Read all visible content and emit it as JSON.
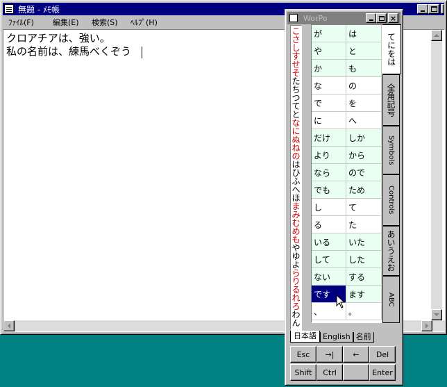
{
  "notepad": {
    "title": "無題 - ﾒﾓ帳",
    "menu": [
      "ﾌｧｲﾙ(F)",
      "編集(E)",
      "検索(S)",
      "ﾍﾙﾌﾟ(H)"
    ],
    "text": "クロアチアは、強い。\n私の名前は、練馬べくぞう"
  },
  "worpo": {
    "title": "WorPo",
    "vertical_strip": [
      {
        "t": "こ",
        "c": "#cc0000"
      },
      {
        "t": "さ",
        "c": "#cc0000"
      },
      {
        "t": "し",
        "c": "#cc0000"
      },
      {
        "t": "す",
        "c": "#cc0000"
      },
      {
        "t": "せ",
        "c": "#cc0000"
      },
      {
        "t": "そ",
        "c": "#cc0000"
      },
      {
        "t": "た",
        "c": "#000"
      },
      {
        "t": "ち",
        "c": "#000"
      },
      {
        "t": "つ",
        "c": "#000"
      },
      {
        "t": "て",
        "c": "#000"
      },
      {
        "t": "と",
        "c": "#000"
      },
      {
        "t": "な",
        "c": "#cc0000"
      },
      {
        "t": "に",
        "c": "#cc0000"
      },
      {
        "t": "ぬ",
        "c": "#cc0000"
      },
      {
        "t": "ね",
        "c": "#cc0000"
      },
      {
        "t": "の",
        "c": "#cc0000"
      },
      {
        "t": "は",
        "c": "#000"
      },
      {
        "t": "ひ",
        "c": "#000"
      },
      {
        "t": "ふ",
        "c": "#000"
      },
      {
        "t": "へ",
        "c": "#000"
      },
      {
        "t": "ほ",
        "c": "#000"
      },
      {
        "t": "ま",
        "c": "#cc0000"
      },
      {
        "t": "み",
        "c": "#cc0000"
      },
      {
        "t": "む",
        "c": "#cc0000"
      },
      {
        "t": "め",
        "c": "#cc0000"
      },
      {
        "t": "も",
        "c": "#cc0000"
      },
      {
        "t": "や",
        "c": "#000"
      },
      {
        "t": "ゆ",
        "c": "#000"
      },
      {
        "t": "よ",
        "c": "#000"
      },
      {
        "t": "ら",
        "c": "#cc0000"
      },
      {
        "t": "り",
        "c": "#cc0000"
      },
      {
        "t": "る",
        "c": "#cc0000"
      },
      {
        "t": "れ",
        "c": "#cc0000"
      },
      {
        "t": "ろ",
        "c": "#cc0000"
      },
      {
        "t": "わ",
        "c": "#000"
      },
      {
        "t": "ん",
        "c": "#000"
      }
    ],
    "words": [
      [
        "が",
        "は"
      ],
      [
        "や",
        "と"
      ],
      [
        "か",
        "も"
      ],
      [
        "な",
        "の"
      ],
      [
        "で",
        "を"
      ],
      [
        "に",
        "へ"
      ],
      [
        "だけ",
        "しか"
      ],
      [
        "より",
        "から"
      ],
      [
        "なら",
        "ので"
      ],
      [
        "でも",
        "ため"
      ],
      [
        "し",
        "て"
      ],
      [
        "る",
        "た"
      ],
      [
        "いる",
        "いた"
      ],
      [
        "して",
        "した"
      ],
      [
        "ない",
        "する"
      ],
      [
        "です",
        "ます"
      ],
      [
        "、",
        "。"
      ]
    ],
    "word_colors": {
      "even": "#e8fff2",
      "odd": "#ffffff",
      "selected": "#000080"
    },
    "selected_row": 15,
    "selected_col": 0,
    "side_tabs": [
      "てにをは",
      "全角記号",
      "Symbols",
      "Controls",
      "あいうえお",
      "ABC"
    ],
    "bottom_tabs": [
      "日本語",
      "English",
      "名前"
    ],
    "keys": [
      [
        "Esc",
        "→|",
        "←",
        "Del"
      ],
      [
        "Shift",
        "Ctrl",
        "",
        "Enter"
      ]
    ]
  }
}
